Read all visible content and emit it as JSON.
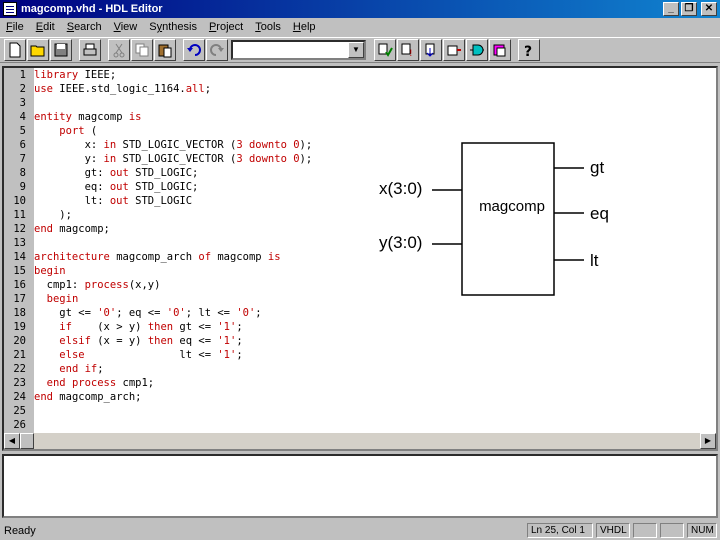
{
  "window": {
    "title": "magcomp.vhd - HDL Editor"
  },
  "menu": [
    {
      "label": "File",
      "mn": "F",
      "rest": "ile"
    },
    {
      "label": "Edit",
      "mn": "E",
      "rest": "dit"
    },
    {
      "label": "Search",
      "mn": "S",
      "rest": "earch"
    },
    {
      "label": "View",
      "mn": "V",
      "rest": "iew"
    },
    {
      "label": "Synthesis",
      "mn": "y",
      "pre": "S",
      "rest": "nthesis"
    },
    {
      "label": "Project",
      "mn": "P",
      "rest": "roject"
    },
    {
      "label": "Tools",
      "mn": "T",
      "rest": "ools"
    },
    {
      "label": "Help",
      "mn": "H",
      "rest": "elp"
    }
  ],
  "toolbar": {
    "combo_value": ""
  },
  "editor": {
    "lines": [
      [
        [
          "kw",
          "library "
        ],
        [
          "tx",
          "IEEE;"
        ]
      ],
      [
        [
          "kw",
          "use "
        ],
        [
          "tx",
          "IEEE.std_logic_1164."
        ],
        [
          "kw",
          "all"
        ],
        [
          "tx",
          ";"
        ]
      ],
      [],
      [
        [
          "kw",
          "entity "
        ],
        [
          "tx",
          "magcomp "
        ],
        [
          "kw",
          "is"
        ]
      ],
      [
        [
          "tx",
          "    "
        ],
        [
          "kw",
          "port "
        ],
        [
          "tx",
          "("
        ]
      ],
      [
        [
          "tx",
          "        x: "
        ],
        [
          "kw",
          "in "
        ],
        [
          "tx",
          "STD_LOGIC_VECTOR ("
        ],
        [
          "kw",
          "3 downto 0"
        ],
        [
          "tx",
          ");"
        ]
      ],
      [
        [
          "tx",
          "        y: "
        ],
        [
          "kw",
          "in "
        ],
        [
          "tx",
          "STD_LOGIC_VECTOR ("
        ],
        [
          "kw",
          "3 downto 0"
        ],
        [
          "tx",
          ");"
        ]
      ],
      [
        [
          "tx",
          "        gt: "
        ],
        [
          "kw",
          "out "
        ],
        [
          "tx",
          "STD_LOGIC;"
        ]
      ],
      [
        [
          "tx",
          "        eq: "
        ],
        [
          "kw",
          "out "
        ],
        [
          "tx",
          "STD_LOGIC;"
        ]
      ],
      [
        [
          "tx",
          "        lt: "
        ],
        [
          "kw",
          "out "
        ],
        [
          "tx",
          "STD_LOGIC"
        ]
      ],
      [
        [
          "tx",
          "    );"
        ]
      ],
      [
        [
          "kw",
          "end "
        ],
        [
          "tx",
          "magcomp;"
        ]
      ],
      [],
      [
        [
          "kw",
          "architecture "
        ],
        [
          "tx",
          "magcomp_arch "
        ],
        [
          "kw",
          "of "
        ],
        [
          "tx",
          "magcomp "
        ],
        [
          "kw",
          "is"
        ]
      ],
      [
        [
          "kw",
          "begin"
        ]
      ],
      [
        [
          "tx",
          "  cmp1: "
        ],
        [
          "kw",
          "process"
        ],
        [
          "tx",
          "(x,y)"
        ]
      ],
      [
        [
          "tx",
          "  "
        ],
        [
          "kw",
          "begin"
        ]
      ],
      [
        [
          "tx",
          "    gt <= "
        ],
        [
          "kw",
          "'0'"
        ],
        [
          "tx",
          "; eq <= "
        ],
        [
          "kw",
          "'0'"
        ],
        [
          "tx",
          "; lt <= "
        ],
        [
          "kw",
          "'0'"
        ],
        [
          "tx",
          ";"
        ]
      ],
      [
        [
          "tx",
          "    "
        ],
        [
          "kw",
          "if    "
        ],
        [
          "tx",
          "(x > y) "
        ],
        [
          "kw",
          "then "
        ],
        [
          "tx",
          "gt <= "
        ],
        [
          "kw",
          "'1'"
        ],
        [
          "tx",
          ";"
        ]
      ],
      [
        [
          "tx",
          "    "
        ],
        [
          "kw",
          "elsif "
        ],
        [
          "tx",
          "(x = y) "
        ],
        [
          "kw",
          "then "
        ],
        [
          "tx",
          "eq <= "
        ],
        [
          "kw",
          "'1'"
        ],
        [
          "tx",
          ";"
        ]
      ],
      [
        [
          "tx",
          "    "
        ],
        [
          "kw",
          "else               "
        ],
        [
          "tx",
          "lt <= "
        ],
        [
          "kw",
          "'1'"
        ],
        [
          "tx",
          ";"
        ]
      ],
      [
        [
          "tx",
          "    "
        ],
        [
          "kw",
          "end if"
        ],
        [
          "tx",
          ";"
        ]
      ],
      [
        [
          "tx",
          "  "
        ],
        [
          "kw",
          "end process "
        ],
        [
          "tx",
          "cmp1;"
        ]
      ],
      [
        [
          "kw",
          "end "
        ],
        [
          "tx",
          "magcomp_arch;"
        ]
      ],
      [],
      []
    ],
    "line_numbers": [
      "1",
      "2",
      "3",
      "4",
      "5",
      "6",
      "7",
      "8",
      "9",
      "10",
      "11",
      "12",
      "13",
      "14",
      "15",
      "16",
      "17",
      "18",
      "19",
      "20",
      "21",
      "22",
      "23",
      "24",
      "25",
      "26"
    ]
  },
  "diagram": {
    "block_label": "magcomp",
    "inputs": [
      "x(3:0)",
      "y(3:0)"
    ],
    "outputs": [
      "gt",
      "eq",
      "lt"
    ]
  },
  "status": {
    "ready": "Ready",
    "position": "Ln 25, Col 1",
    "language": "VHDL",
    "num": "NUM"
  },
  "colors": {
    "keyword": "#c00000",
    "titlebar": "#000080"
  }
}
